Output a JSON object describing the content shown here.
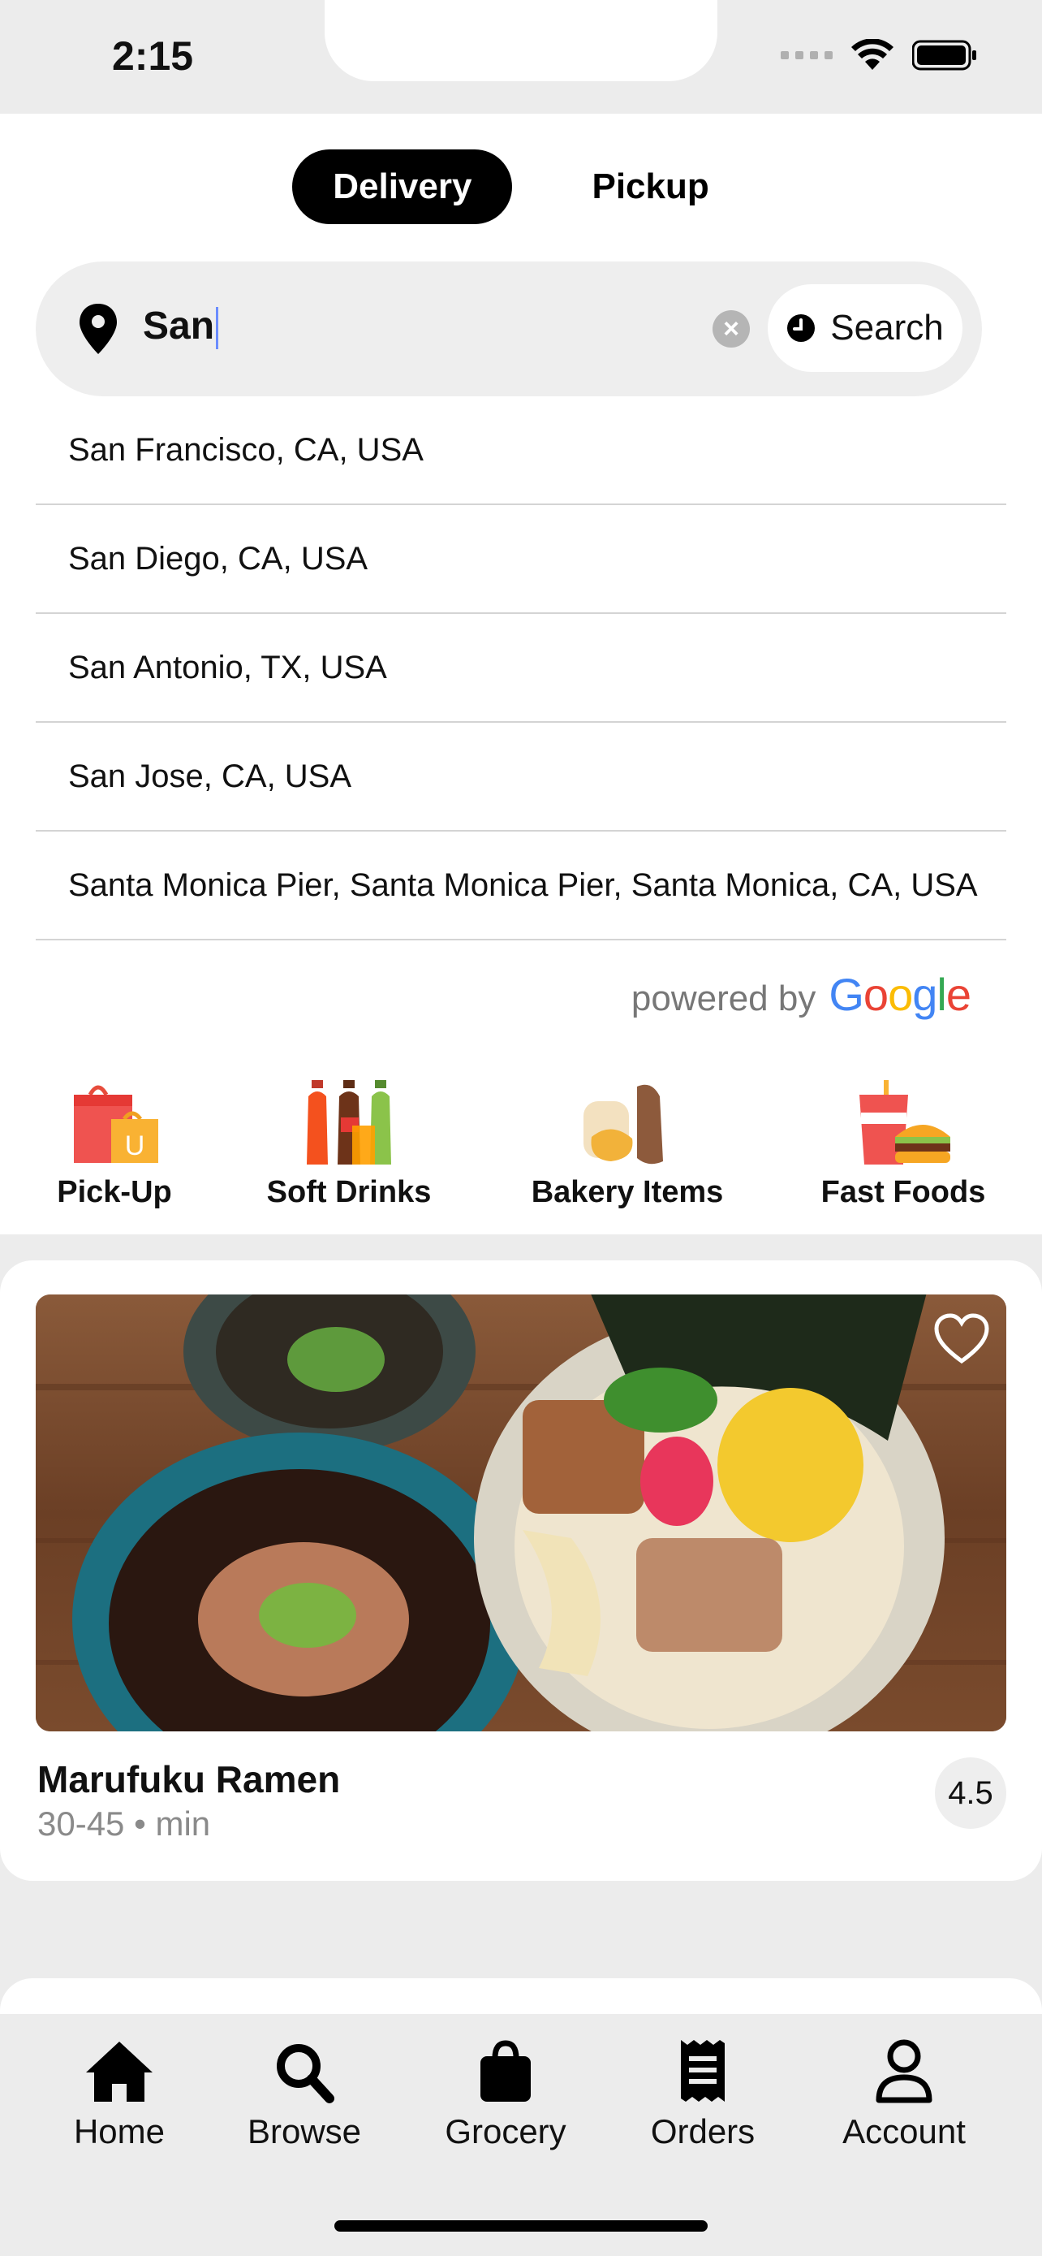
{
  "status_bar": {
    "time": "2:15"
  },
  "mode_toggle": {
    "delivery": "Delivery",
    "pickup": "Pickup"
  },
  "search": {
    "value": "San",
    "button_label": "Search"
  },
  "suggestions": [
    "San Francisco, CA, USA",
    "San Diego, CA, USA",
    "San Antonio, TX, USA",
    "San Jose, CA, USA",
    "Santa Monica Pier, Santa Monica Pier, Santa Monica, CA, USA"
  ],
  "attribution": {
    "powered_by": "powered by",
    "brand": "Google"
  },
  "categories": [
    {
      "label": "Pick-Up",
      "icon": "shopping-bags-icon"
    },
    {
      "label": "Soft Drinks",
      "icon": "soda-bottles-icon"
    },
    {
      "label": "Bakery Items",
      "icon": "bread-icon"
    },
    {
      "label": "Fast Foods",
      "icon": "burger-drink-icon"
    }
  ],
  "restaurant": {
    "name": "Marufuku Ramen",
    "time": "30-45 • min",
    "rating": "4.5"
  },
  "bottom_nav": [
    {
      "label": "Home",
      "icon": "home-icon"
    },
    {
      "label": "Browse",
      "icon": "search-icon"
    },
    {
      "label": "Grocery",
      "icon": "shopping-bag-icon"
    },
    {
      "label": "Orders",
      "icon": "receipt-icon"
    },
    {
      "label": "Account",
      "icon": "person-icon"
    }
  ],
  "colors": {
    "accent": "#000000",
    "background": "#ececec",
    "google_blue": "#4285F4",
    "google_red": "#EA4335",
    "google_yellow": "#FBBC05",
    "google_green": "#34A853"
  }
}
